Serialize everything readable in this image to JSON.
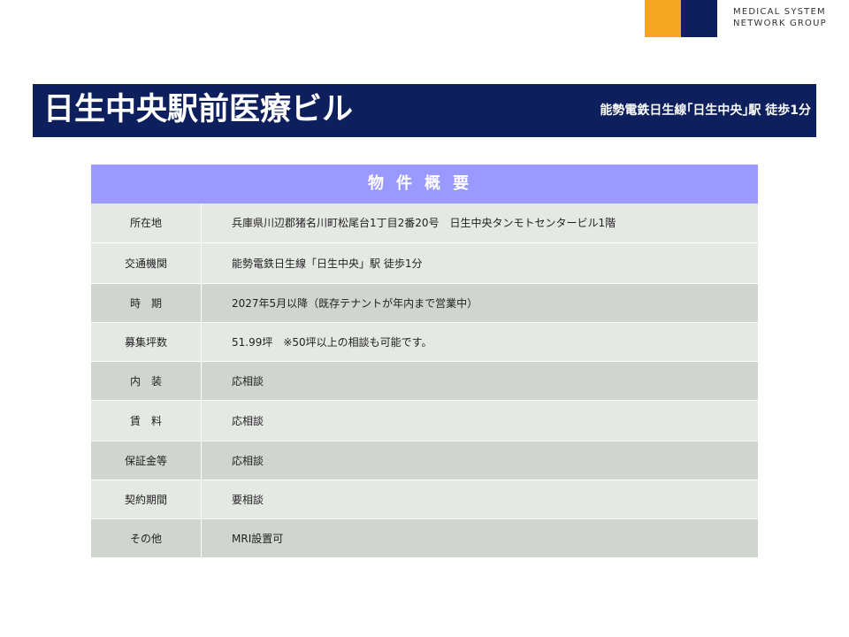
{
  "logo": {
    "line1": "MEDICAL SYSTEM",
    "line2": "NETWORK GROUP",
    "colors": {
      "orange": "#f5a623",
      "navy": "#0e1f5b"
    }
  },
  "header": {
    "title": "日生中央駅前医療ビル",
    "access": "能勢電鉄日生線｢日生中央｣駅 徒歩1分",
    "bg_color": "#0d1f5c"
  },
  "summary": {
    "heading": "物件概要",
    "heading_color": "#9999ff",
    "rows": [
      {
        "label": "所在地",
        "value": "兵庫県川辺郡猪名川町松尾台1丁目2番20号　日生中央タンモトセンタービル1階"
      },
      {
        "label": "交通機関",
        "value": "能勢電鉄日生線「日生中央」駅 徒歩1分"
      },
      {
        "label": "時　期",
        "value": "2027年5月以降（既存テナントが年内まで営業中）"
      },
      {
        "label": "募集坪数",
        "value": "51.99坪　※50坪以上の相談も可能です。"
      },
      {
        "label": "内　装",
        "value": "応相談"
      },
      {
        "label": "賃　料",
        "value": "応相談"
      },
      {
        "label": "保証金等",
        "value": "応相談"
      },
      {
        "label": "契約期間",
        "value": "要相談"
      },
      {
        "label": "その他",
        "value": "MRI設置可"
      }
    ]
  }
}
